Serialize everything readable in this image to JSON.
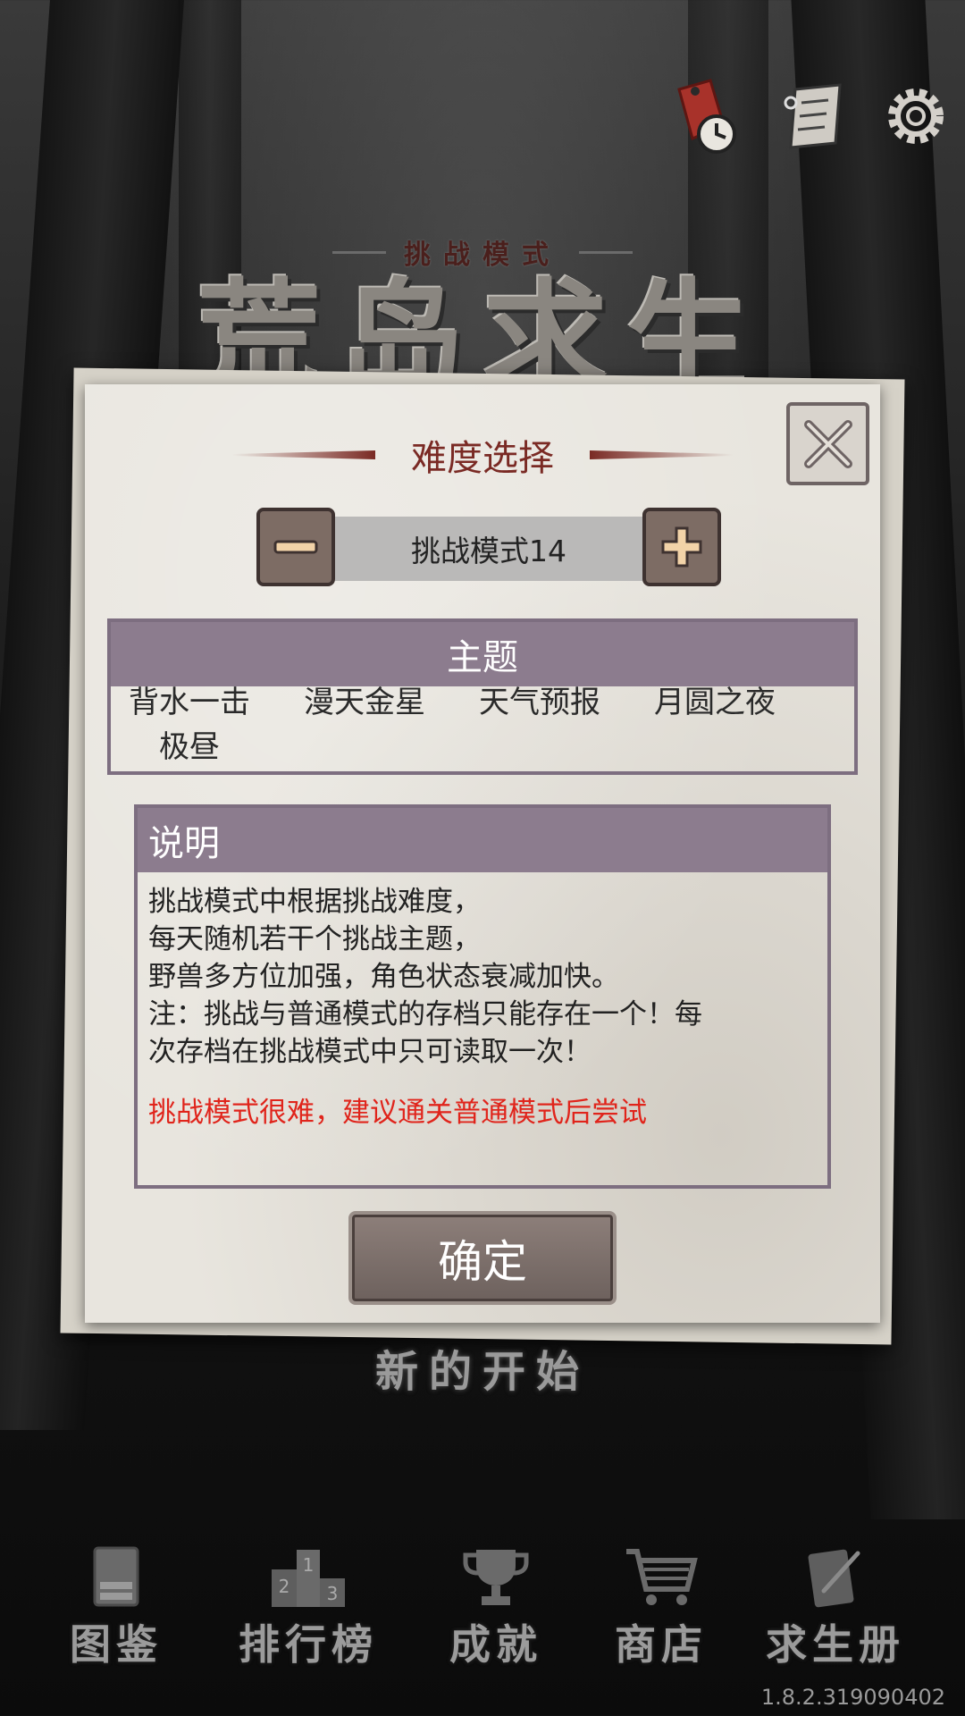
{
  "header": {
    "mode_label": "挑战模式",
    "game_title": "荒岛求生"
  },
  "top_icons": [
    "clock-tag-icon",
    "scroll-icon",
    "gear-icon"
  ],
  "dialog": {
    "title": "难度选择",
    "difficulty_value": "挑战模式14",
    "theme_header": "主题",
    "themes": [
      "背水一击",
      "漫天金星",
      "天气预报",
      "月圆之夜",
      "极昼"
    ],
    "desc_header": "说明",
    "desc_lines": [
      "挑战模式中根据挑战难度，",
      "每天随机若干个挑战主题，",
      "野兽多方位加强，角色状态衰减加快。",
      "注：挑战与普通模式的存档只能存在一个！每",
      "次存档在挑战模式中只可读取一次！"
    ],
    "warning": "挑战模式很难，建议通关普通模式后尝试",
    "confirm_label": "确定"
  },
  "new_start_label": "新的开始",
  "bottom_nav": [
    {
      "label": "图鉴",
      "icon": "book-icon"
    },
    {
      "label": "排行榜",
      "icon": "podium-icon"
    },
    {
      "label": "成就",
      "icon": "trophy-icon"
    },
    {
      "label": "商店",
      "icon": "cart-icon"
    },
    {
      "label": "求生册",
      "icon": "notebook-icon"
    }
  ],
  "version": "1.8.2.319090402",
  "colors": {
    "accent": "#7a2a24",
    "section_header": "#8c7c8e",
    "warning": "#e0241b"
  }
}
